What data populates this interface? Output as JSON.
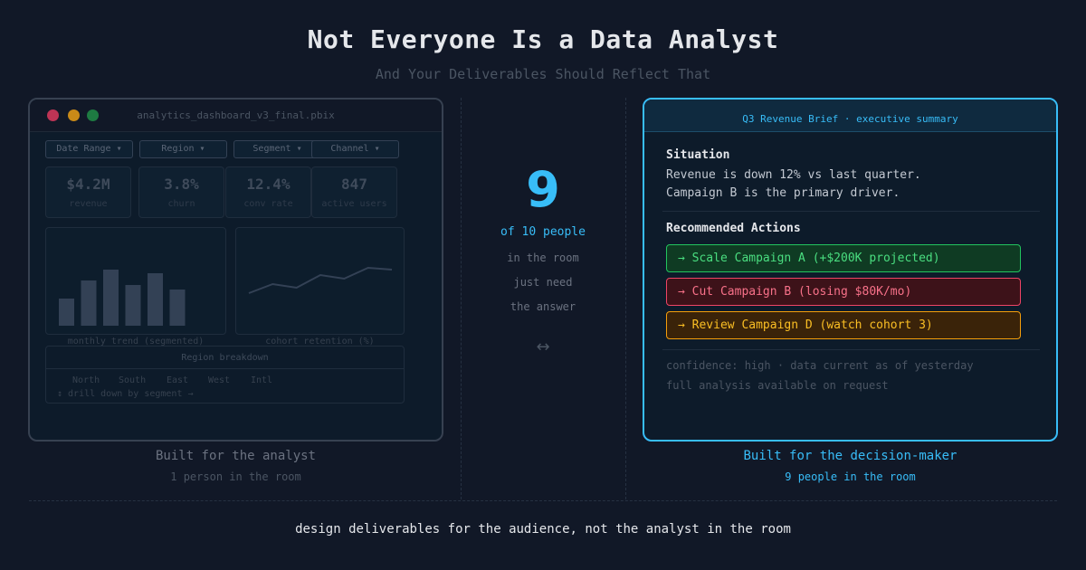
{
  "header": {
    "title": "Not Everyone Is a Data Analyst",
    "subtitle": "And Your Deliverables Should Reflect That"
  },
  "analyst_window": {
    "filename": "analytics_dashboard_v3_final.pbix",
    "filters": [
      "Date Range ▾",
      "Region ▾",
      "Segment ▾",
      "Channel ▾"
    ],
    "kpis": [
      {
        "value": "$4.2M",
        "label": "revenue"
      },
      {
        "value": "3.8%",
        "label": "churn"
      },
      {
        "value": "12.4%",
        "label": "conv rate"
      },
      {
        "value": "847",
        "label": "active users"
      }
    ],
    "bar_panel": {
      "caption": "monthly trend (segmented)",
      "values": [
        30,
        50,
        62,
        45,
        58,
        40
      ]
    },
    "line_panel": {
      "caption": "cohort retention (%)",
      "values": [
        12,
        22,
        18,
        32,
        28,
        40,
        38
      ]
    },
    "region": {
      "title": "Region breakdown",
      "columns": [
        "North",
        "South",
        "East",
        "West",
        "Intl"
      ],
      "drill_text": "↕ drill down by segment →"
    },
    "caption_main": "Built for the analyst",
    "caption_sub": "1 person in the room"
  },
  "middle": {
    "big_number": "9",
    "of_line": "of 10 people",
    "lines": [
      "in the room",
      "just need",
      "the answer"
    ],
    "arrow": "↔"
  },
  "decision_window": {
    "title": "Q3 Revenue Brief · executive summary",
    "situation_heading": "Situation",
    "situation_lines": [
      "Revenue is down 12% vs last quarter.",
      "Campaign B is the primary driver."
    ],
    "actions_heading": "Recommended Actions",
    "actions": [
      "→ Scale Campaign A (+$200K projected)",
      "→ Cut Campaign B (losing $80K/mo)",
      "→ Review Campaign D (watch cohort 3)"
    ],
    "footer_lines": [
      "confidence: high · data current as of yesterday",
      "full analysis available on request"
    ],
    "caption_main": "Built for the decision-maker",
    "caption_sub": "9 people in the room"
  },
  "footer": {
    "tagline": "design deliverables for the audience, not the analyst in the room"
  },
  "colors": {
    "background": "#111827",
    "accent": "#38bdf8",
    "green": "#22c55e",
    "red": "#ef4465",
    "amber": "#f59e0b"
  }
}
